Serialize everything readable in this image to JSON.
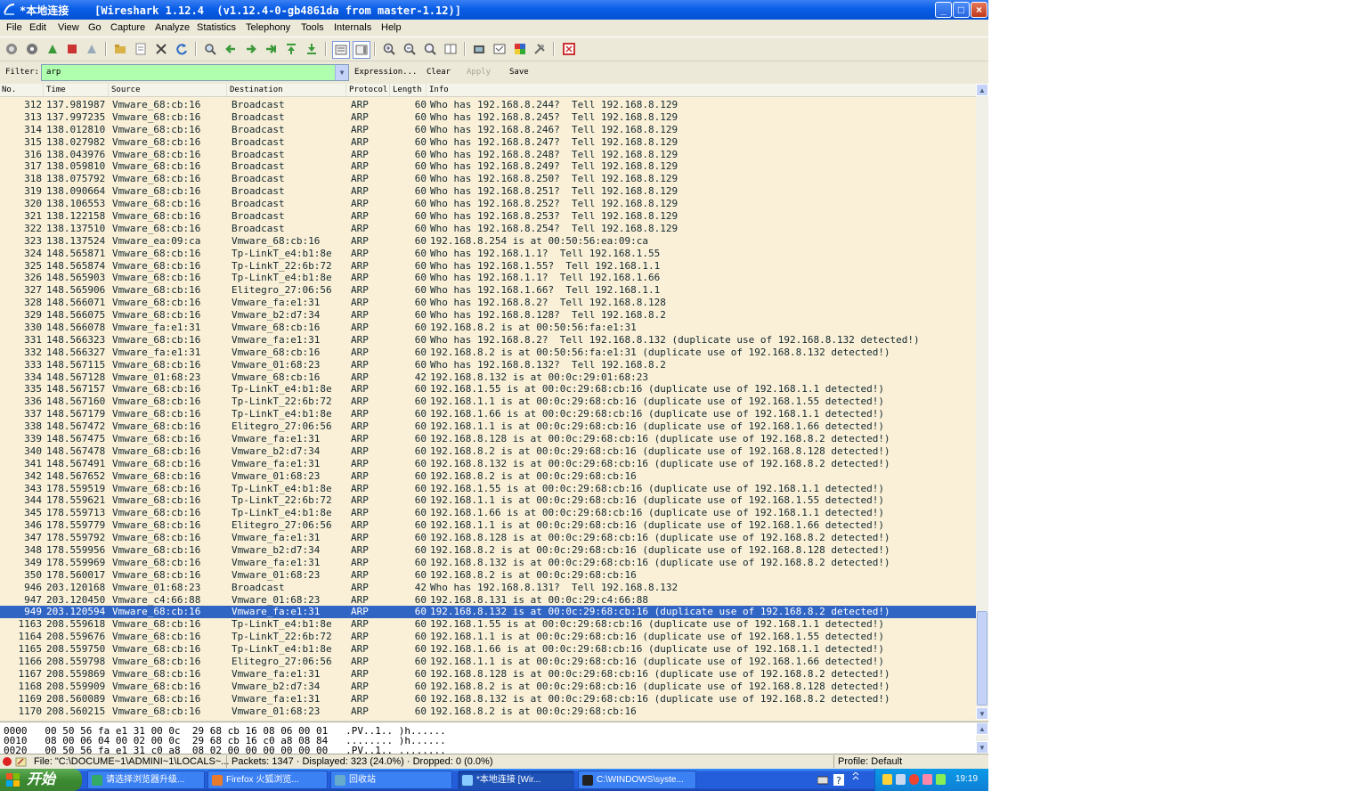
{
  "window": {
    "title": "*本地连接    [Wireshark 1.12.4  (v1.12.4-0-gb4861da from master-1.12)]",
    "buttons": {
      "minimize": "_",
      "maximize": "□",
      "close": "×"
    }
  },
  "menubar": [
    "File",
    "Edit",
    "View",
    "Go",
    "Capture",
    "Analyze",
    "Statistics",
    "Telephony",
    "Tools",
    "Internals",
    "Help"
  ],
  "toolbar": [
    "start-capture-icon",
    "capture-options-icon",
    "restart-capture-icon",
    "stop-capture-icon",
    "reload-capture-icon",
    "open-file-icon",
    "save-file-icon",
    "close-file-icon",
    "reload-file-icon",
    "find-packet-icon",
    "go-back-icon",
    "go-forward-icon",
    "go-to-packet-icon",
    "go-first-icon",
    "go-last-icon",
    "colorize-icon",
    "autoscroll-icon",
    "zoom-in-icon",
    "zoom-out-icon",
    "zoom-normal-icon",
    "resize-columns-icon",
    "capture-filters-icon",
    "display-filters-icon",
    "coloring-rules-icon",
    "preferences-icon",
    "help-icon"
  ],
  "filter": {
    "label": "Filter:",
    "value": "arp",
    "expression": "Expression...",
    "clear": "Clear",
    "apply": "Apply",
    "save": "Save"
  },
  "columns": {
    "no": "No.",
    "time": "Time",
    "source": "Source",
    "destination": "Destination",
    "protocol": "Protocol",
    "length": "Length",
    "info": "Info"
  },
  "packets": [
    [
      "312",
      "137.981987",
      "Vmware_68:cb:16",
      "Broadcast",
      "ARP",
      "60",
      "Who has 192.168.8.244?  Tell 192.168.8.129"
    ],
    [
      "313",
      "137.997235",
      "Vmware_68:cb:16",
      "Broadcast",
      "ARP",
      "60",
      "Who has 192.168.8.245?  Tell 192.168.8.129"
    ],
    [
      "314",
      "138.012810",
      "Vmware_68:cb:16",
      "Broadcast",
      "ARP",
      "60",
      "Who has 192.168.8.246?  Tell 192.168.8.129"
    ],
    [
      "315",
      "138.027982",
      "Vmware_68:cb:16",
      "Broadcast",
      "ARP",
      "60",
      "Who has 192.168.8.247?  Tell 192.168.8.129"
    ],
    [
      "316",
      "138.043976",
      "Vmware_68:cb:16",
      "Broadcast",
      "ARP",
      "60",
      "Who has 192.168.8.248?  Tell 192.168.8.129"
    ],
    [
      "317",
      "138.059810",
      "Vmware_68:cb:16",
      "Broadcast",
      "ARP",
      "60",
      "Who has 192.168.8.249?  Tell 192.168.8.129"
    ],
    [
      "318",
      "138.075792",
      "Vmware_68:cb:16",
      "Broadcast",
      "ARP",
      "60",
      "Who has 192.168.8.250?  Tell 192.168.8.129"
    ],
    [
      "319",
      "138.090664",
      "Vmware_68:cb:16",
      "Broadcast",
      "ARP",
      "60",
      "Who has 192.168.8.251?  Tell 192.168.8.129"
    ],
    [
      "320",
      "138.106553",
      "Vmware_68:cb:16",
      "Broadcast",
      "ARP",
      "60",
      "Who has 192.168.8.252?  Tell 192.168.8.129"
    ],
    [
      "321",
      "138.122158",
      "Vmware_68:cb:16",
      "Broadcast",
      "ARP",
      "60",
      "Who has 192.168.8.253?  Tell 192.168.8.129"
    ],
    [
      "322",
      "138.137510",
      "Vmware_68:cb:16",
      "Broadcast",
      "ARP",
      "60",
      "Who has 192.168.8.254?  Tell 192.168.8.129"
    ],
    [
      "323",
      "138.137524",
      "Vmware_ea:09:ca",
      "Vmware_68:cb:16",
      "ARP",
      "60",
      "192.168.8.254 is at 00:50:56:ea:09:ca"
    ],
    [
      "324",
      "148.565871",
      "Vmware_68:cb:16",
      "Tp-LinkT_e4:b1:8e",
      "ARP",
      "60",
      "Who has 192.168.1.1?  Tell 192.168.1.55"
    ],
    [
      "325",
      "148.565874",
      "Vmware_68:cb:16",
      "Tp-LinkT_22:6b:72",
      "ARP",
      "60",
      "Who has 192.168.1.55?  Tell 192.168.1.1"
    ],
    [
      "326",
      "148.565903",
      "Vmware_68:cb:16",
      "Tp-LinkT_e4:b1:8e",
      "ARP",
      "60",
      "Who has 192.168.1.1?  Tell 192.168.1.66"
    ],
    [
      "327",
      "148.565906",
      "Vmware_68:cb:16",
      "Elitegro_27:06:56",
      "ARP",
      "60",
      "Who has 192.168.1.66?  Tell 192.168.1.1"
    ],
    [
      "328",
      "148.566071",
      "Vmware_68:cb:16",
      "Vmware_fa:e1:31",
      "ARP",
      "60",
      "Who has 192.168.8.2?  Tell 192.168.8.128"
    ],
    [
      "329",
      "148.566075",
      "Vmware_68:cb:16",
      "Vmware_b2:d7:34",
      "ARP",
      "60",
      "Who has 192.168.8.128?  Tell 192.168.8.2"
    ],
    [
      "330",
      "148.566078",
      "Vmware_fa:e1:31",
      "Vmware_68:cb:16",
      "ARP",
      "60",
      "192.168.8.2 is at 00:50:56:fa:e1:31"
    ],
    [
      "331",
      "148.566323",
      "Vmware_68:cb:16",
      "Vmware_fa:e1:31",
      "ARP",
      "60",
      "Who has 192.168.8.2?  Tell 192.168.8.132 (duplicate use of 192.168.8.132 detected!)"
    ],
    [
      "332",
      "148.566327",
      "Vmware_fa:e1:31",
      "Vmware_68:cb:16",
      "ARP",
      "60",
      "192.168.8.2 is at 00:50:56:fa:e1:31 (duplicate use of 192.168.8.132 detected!)"
    ],
    [
      "333",
      "148.567115",
      "Vmware_68:cb:16",
      "Vmware_01:68:23",
      "ARP",
      "60",
      "Who has 192.168.8.132?  Tell 192.168.8.2"
    ],
    [
      "334",
      "148.567128",
      "Vmware_01:68:23",
      "Vmware_68:cb:16",
      "ARP",
      "42",
      "192.168.8.132 is at 00:0c:29:01:68:23"
    ],
    [
      "335",
      "148.567157",
      "Vmware_68:cb:16",
      "Tp-LinkT_e4:b1:8e",
      "ARP",
      "60",
      "192.168.1.55 is at 00:0c:29:68:cb:16 (duplicate use of 192.168.1.1 detected!)"
    ],
    [
      "336",
      "148.567160",
      "Vmware_68:cb:16",
      "Tp-LinkT_22:6b:72",
      "ARP",
      "60",
      "192.168.1.1 is at 00:0c:29:68:cb:16 (duplicate use of 192.168.1.55 detected!)"
    ],
    [
      "337",
      "148.567179",
      "Vmware_68:cb:16",
      "Tp-LinkT_e4:b1:8e",
      "ARP",
      "60",
      "192.168.1.66 is at 00:0c:29:68:cb:16 (duplicate use of 192.168.1.1 detected!)"
    ],
    [
      "338",
      "148.567472",
      "Vmware_68:cb:16",
      "Elitegro_27:06:56",
      "ARP",
      "60",
      "192.168.1.1 is at 00:0c:29:68:cb:16 (duplicate use of 192.168.1.66 detected!)"
    ],
    [
      "339",
      "148.567475",
      "Vmware_68:cb:16",
      "Vmware_fa:e1:31",
      "ARP",
      "60",
      "192.168.8.128 is at 00:0c:29:68:cb:16 (duplicate use of 192.168.8.2 detected!)"
    ],
    [
      "340",
      "148.567478",
      "Vmware_68:cb:16",
      "Vmware_b2:d7:34",
      "ARP",
      "60",
      "192.168.8.2 is at 00:0c:29:68:cb:16 (duplicate use of 192.168.8.128 detected!)"
    ],
    [
      "341",
      "148.567491",
      "Vmware_68:cb:16",
      "Vmware_fa:e1:31",
      "ARP",
      "60",
      "192.168.8.132 is at 00:0c:29:68:cb:16 (duplicate use of 192.168.8.2 detected!)"
    ],
    [
      "342",
      "148.567652",
      "Vmware_68:cb:16",
      "Vmware_01:68:23",
      "ARP",
      "60",
      "192.168.8.2 is at 00:0c:29:68:cb:16"
    ],
    [
      "343",
      "178.559519",
      "Vmware_68:cb:16",
      "Tp-LinkT_e4:b1:8e",
      "ARP",
      "60",
      "192.168.1.55 is at 00:0c:29:68:cb:16 (duplicate use of 192.168.1.1 detected!)"
    ],
    [
      "344",
      "178.559621",
      "Vmware_68:cb:16",
      "Tp-LinkT_22:6b:72",
      "ARP",
      "60",
      "192.168.1.1 is at 00:0c:29:68:cb:16 (duplicate use of 192.168.1.55 detected!)"
    ],
    [
      "345",
      "178.559713",
      "Vmware_68:cb:16",
      "Tp-LinkT_e4:b1:8e",
      "ARP",
      "60",
      "192.168.1.66 is at 00:0c:29:68:cb:16 (duplicate use of 192.168.1.1 detected!)"
    ],
    [
      "346",
      "178.559779",
      "Vmware_68:cb:16",
      "Elitegro_27:06:56",
      "ARP",
      "60",
      "192.168.1.1 is at 00:0c:29:68:cb:16 (duplicate use of 192.168.1.66 detected!)"
    ],
    [
      "347",
      "178.559792",
      "Vmware_68:cb:16",
      "Vmware_fa:e1:31",
      "ARP",
      "60",
      "192.168.8.128 is at 00:0c:29:68:cb:16 (duplicate use of 192.168.8.2 detected!)"
    ],
    [
      "348",
      "178.559956",
      "Vmware_68:cb:16",
      "Vmware_b2:d7:34",
      "ARP",
      "60",
      "192.168.8.2 is at 00:0c:29:68:cb:16 (duplicate use of 192.168.8.128 detected!)"
    ],
    [
      "349",
      "178.559969",
      "Vmware_68:cb:16",
      "Vmware_fa:e1:31",
      "ARP",
      "60",
      "192.168.8.132 is at 00:0c:29:68:cb:16 (duplicate use of 192.168.8.2 detected!)"
    ],
    [
      "350",
      "178.560017",
      "Vmware_68:cb:16",
      "Vmware_01:68:23",
      "ARP",
      "60",
      "192.168.8.2 is at 00:0c:29:68:cb:16"
    ],
    [
      "946",
      "203.120168",
      "Vmware_01:68:23",
      "Broadcast",
      "ARP",
      "42",
      "Who has 192.168.8.131?  Tell 192.168.8.132"
    ],
    [
      "947",
      "203.120450",
      "Vmware_c4:66:88",
      "Vmware_01:68:23",
      "ARP",
      "60",
      "192.168.8.131 is at 00:0c:29:c4:66:88"
    ],
    [
      "949",
      "203.120594",
      "Vmware_68:cb:16",
      "Vmware_fa:e1:31",
      "ARP",
      "60",
      "192.168.8.132 is at 00:0c:29:68:cb:16 (duplicate use of 192.168.8.2 detected!)"
    ],
    [
      "1163",
      "208.559618",
      "Vmware_68:cb:16",
      "Tp-LinkT_e4:b1:8e",
      "ARP",
      "60",
      "192.168.1.55 is at 00:0c:29:68:cb:16 (duplicate use of 192.168.1.1 detected!)"
    ],
    [
      "1164",
      "208.559676",
      "Vmware_68:cb:16",
      "Tp-LinkT_22:6b:72",
      "ARP",
      "60",
      "192.168.1.1 is at 00:0c:29:68:cb:16 (duplicate use of 192.168.1.55 detected!)"
    ],
    [
      "1165",
      "208.559750",
      "Vmware_68:cb:16",
      "Tp-LinkT_e4:b1:8e",
      "ARP",
      "60",
      "192.168.1.66 is at 00:0c:29:68:cb:16 (duplicate use of 192.168.1.1 detected!)"
    ],
    [
      "1166",
      "208.559798",
      "Vmware_68:cb:16",
      "Elitegro_27:06:56",
      "ARP",
      "60",
      "192.168.1.1 is at 00:0c:29:68:cb:16 (duplicate use of 192.168.1.66 detected!)"
    ],
    [
      "1167",
      "208.559869",
      "Vmware_68:cb:16",
      "Vmware_fa:e1:31",
      "ARP",
      "60",
      "192.168.8.128 is at 00:0c:29:68:cb:16 (duplicate use of 192.168.8.2 detected!)"
    ],
    [
      "1168",
      "208.559909",
      "Vmware_68:cb:16",
      "Vmware_b2:d7:34",
      "ARP",
      "60",
      "192.168.8.2 is at 00:0c:29:68:cb:16 (duplicate use of 192.168.8.128 detected!)"
    ],
    [
      "1169",
      "208.560089",
      "Vmware_68:cb:16",
      "Vmware_fa:e1:31",
      "ARP",
      "60",
      "192.168.8.132 is at 00:0c:29:68:cb:16 (duplicate use of 192.168.8.2 detected!)"
    ],
    [
      "1170",
      "208.560215",
      "Vmware_68:cb:16",
      "Vmware_01:68:23",
      "ARP",
      "60",
      "192.168.8.2 is at 00:0c:29:68:cb:16"
    ]
  ],
  "selected_packet": "949",
  "hex": [
    "0000   00 50 56 fa e1 31 00 0c  29 68 cb 16 08 06 00 01   .PV..1.. )h......",
    "0010   08 00 06 04 00 02 00 0c  29 68 cb 16 c0 a8 08 84   ........ )h......",
    "0020   00 50 56 fa e1 31 c0 a8  08 02 00 00 00 00 00 00   .PV..1.. ........"
  ],
  "statusbar": {
    "file": "File: \"C:\\DOCUME~1\\ADMINI~1\\LOCALS~...",
    "packets": "Packets: 1347 · Displayed: 323 (24.0%) · Dropped: 0 (0.0%)",
    "profile": "Profile: Default"
  },
  "taskbar": {
    "start": "开始",
    "tasks": [
      "请选择浏览器升级...",
      "Firefox 火狐浏览...",
      "回收站",
      "*本地连接    [Wir...",
      "C:\\WINDOWS\\syste..."
    ],
    "time": "19:19"
  },
  "colors": {
    "row_bg": "#faf0d7",
    "row_fg": "#12272e",
    "selected_bg": "#3165c4",
    "filter_ok": "#afffaf"
  }
}
